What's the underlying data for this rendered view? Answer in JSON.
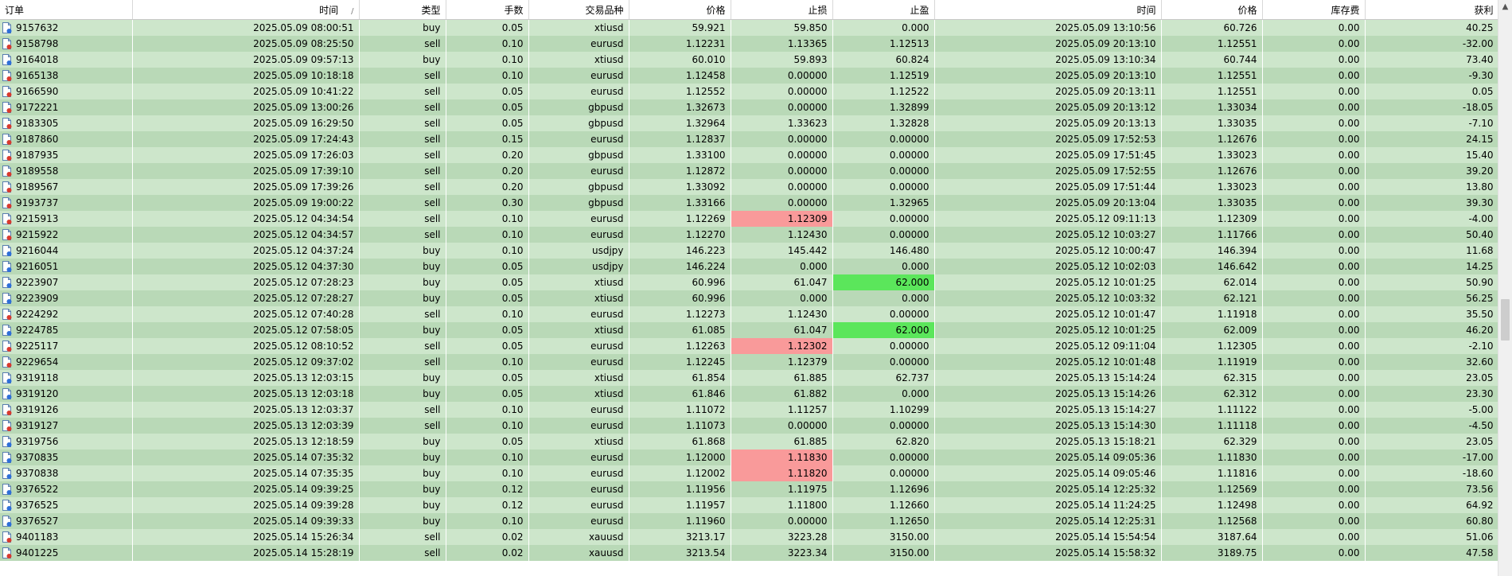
{
  "header": {
    "columns": [
      "订单",
      "时间",
      "类型",
      "手数",
      "交易品种",
      "价格",
      "止损",
      "止盈",
      "时间",
      "价格",
      "库存费",
      "获利"
    ],
    "sort_indicator": "/"
  },
  "rows": [
    {
      "order": "9157632",
      "open_time": "2025.05.09 08:00:51",
      "type": "buy",
      "lots": "0.05",
      "symbol": "xtiusd",
      "price": "59.921",
      "sl": "59.850",
      "tp": "0.000",
      "close_time": "2025.05.09 13:10:56",
      "close_price": "60.726",
      "swap": "0.00",
      "profit": "40.25"
    },
    {
      "order": "9158798",
      "open_time": "2025.05.09 08:25:50",
      "type": "sell",
      "lots": "0.10",
      "symbol": "eurusd",
      "price": "1.12231",
      "sl": "1.13365",
      "tp": "1.12513",
      "close_time": "2025.05.09 20:13:10",
      "close_price": "1.12551",
      "swap": "0.00",
      "profit": "-32.00"
    },
    {
      "order": "9164018",
      "open_time": "2025.05.09 09:57:13",
      "type": "buy",
      "lots": "0.10",
      "symbol": "xtiusd",
      "price": "60.010",
      "sl": "59.893",
      "tp": "60.824",
      "close_time": "2025.05.09 13:10:34",
      "close_price": "60.744",
      "swap": "0.00",
      "profit": "73.40"
    },
    {
      "order": "9165138",
      "open_time": "2025.05.09 10:18:18",
      "type": "sell",
      "lots": "0.10",
      "symbol": "eurusd",
      "price": "1.12458",
      "sl": "0.00000",
      "tp": "1.12519",
      "close_time": "2025.05.09 20:13:10",
      "close_price": "1.12551",
      "swap": "0.00",
      "profit": "-9.30"
    },
    {
      "order": "9166590",
      "open_time": "2025.05.09 10:41:22",
      "type": "sell",
      "lots": "0.05",
      "symbol": "eurusd",
      "price": "1.12552",
      "sl": "0.00000",
      "tp": "1.12522",
      "close_time": "2025.05.09 20:13:11",
      "close_price": "1.12551",
      "swap": "0.00",
      "profit": "0.05"
    },
    {
      "order": "9172221",
      "open_time": "2025.05.09 13:00:26",
      "type": "sell",
      "lots": "0.05",
      "symbol": "gbpusd",
      "price": "1.32673",
      "sl": "0.00000",
      "tp": "1.32899",
      "close_time": "2025.05.09 20:13:12",
      "close_price": "1.33034",
      "swap": "0.00",
      "profit": "-18.05"
    },
    {
      "order": "9183305",
      "open_time": "2025.05.09 16:29:50",
      "type": "sell",
      "lots": "0.05",
      "symbol": "gbpusd",
      "price": "1.32964",
      "sl": "1.33623",
      "tp": "1.32828",
      "close_time": "2025.05.09 20:13:13",
      "close_price": "1.33035",
      "swap": "0.00",
      "profit": "-7.10"
    },
    {
      "order": "9187860",
      "open_time": "2025.05.09 17:24:43",
      "type": "sell",
      "lots": "0.15",
      "symbol": "eurusd",
      "price": "1.12837",
      "sl": "0.00000",
      "tp": "0.00000",
      "close_time": "2025.05.09 17:52:53",
      "close_price": "1.12676",
      "swap": "0.00",
      "profit": "24.15"
    },
    {
      "order": "9187935",
      "open_time": "2025.05.09 17:26:03",
      "type": "sell",
      "lots": "0.20",
      "symbol": "gbpusd",
      "price": "1.33100",
      "sl": "0.00000",
      "tp": "0.00000",
      "close_time": "2025.05.09 17:51:45",
      "close_price": "1.33023",
      "swap": "0.00",
      "profit": "15.40"
    },
    {
      "order": "9189558",
      "open_time": "2025.05.09 17:39:10",
      "type": "sell",
      "lots": "0.20",
      "symbol": "eurusd",
      "price": "1.12872",
      "sl": "0.00000",
      "tp": "0.00000",
      "close_time": "2025.05.09 17:52:55",
      "close_price": "1.12676",
      "swap": "0.00",
      "profit": "39.20"
    },
    {
      "order": "9189567",
      "open_time": "2025.05.09 17:39:26",
      "type": "sell",
      "lots": "0.20",
      "symbol": "gbpusd",
      "price": "1.33092",
      "sl": "0.00000",
      "tp": "0.00000",
      "close_time": "2025.05.09 17:51:44",
      "close_price": "1.33023",
      "swap": "0.00",
      "profit": "13.80"
    },
    {
      "order": "9193737",
      "open_time": "2025.05.09 19:00:22",
      "type": "sell",
      "lots": "0.30",
      "symbol": "gbpusd",
      "price": "1.33166",
      "sl": "0.00000",
      "tp": "1.32965",
      "close_time": "2025.05.09 20:13:04",
      "close_price": "1.33035",
      "swap": "0.00",
      "profit": "39.30"
    },
    {
      "order": "9215913",
      "open_time": "2025.05.12 04:34:54",
      "type": "sell",
      "lots": "0.10",
      "symbol": "eurusd",
      "price": "1.12269",
      "sl": "1.12309",
      "tp": "0.00000",
      "close_time": "2025.05.12 09:11:13",
      "close_price": "1.12309",
      "swap": "0.00",
      "profit": "-4.00",
      "sl_hl": "red"
    },
    {
      "order": "9215922",
      "open_time": "2025.05.12 04:34:57",
      "type": "sell",
      "lots": "0.10",
      "symbol": "eurusd",
      "price": "1.12270",
      "sl": "1.12430",
      "tp": "0.00000",
      "close_time": "2025.05.12 10:03:27",
      "close_price": "1.11766",
      "swap": "0.00",
      "profit": "50.40"
    },
    {
      "order": "9216044",
      "open_time": "2025.05.12 04:37:24",
      "type": "buy",
      "lots": "0.10",
      "symbol": "usdjpy",
      "price": "146.223",
      "sl": "145.442",
      "tp": "146.480",
      "close_time": "2025.05.12 10:00:47",
      "close_price": "146.394",
      "swap": "0.00",
      "profit": "11.68"
    },
    {
      "order": "9216051",
      "open_time": "2025.05.12 04:37:30",
      "type": "buy",
      "lots": "0.05",
      "symbol": "usdjpy",
      "price": "146.224",
      "sl": "0.000",
      "tp": "0.000",
      "close_time": "2025.05.12 10:02:03",
      "close_price": "146.642",
      "swap": "0.00",
      "profit": "14.25"
    },
    {
      "order": "9223907",
      "open_time": "2025.05.12 07:28:23",
      "type": "buy",
      "lots": "0.05",
      "symbol": "xtiusd",
      "price": "60.996",
      "sl": "61.047",
      "tp": "62.000",
      "close_time": "2025.05.12 10:01:25",
      "close_price": "62.014",
      "swap": "0.00",
      "profit": "50.90",
      "tp_hl": "green"
    },
    {
      "order": "9223909",
      "open_time": "2025.05.12 07:28:27",
      "type": "buy",
      "lots": "0.05",
      "symbol": "xtiusd",
      "price": "60.996",
      "sl": "0.000",
      "tp": "0.000",
      "close_time": "2025.05.12 10:03:32",
      "close_price": "62.121",
      "swap": "0.00",
      "profit": "56.25"
    },
    {
      "order": "9224292",
      "open_time": "2025.05.12 07:40:28",
      "type": "sell",
      "lots": "0.10",
      "symbol": "eurusd",
      "price": "1.12273",
      "sl": "1.12430",
      "tp": "0.00000",
      "close_time": "2025.05.12 10:01:47",
      "close_price": "1.11918",
      "swap": "0.00",
      "profit": "35.50"
    },
    {
      "order": "9224785",
      "open_time": "2025.05.12 07:58:05",
      "type": "buy",
      "lots": "0.05",
      "symbol": "xtiusd",
      "price": "61.085",
      "sl": "61.047",
      "tp": "62.000",
      "close_time": "2025.05.12 10:01:25",
      "close_price": "62.009",
      "swap": "0.00",
      "profit": "46.20",
      "tp_hl": "green"
    },
    {
      "order": "9225117",
      "open_time": "2025.05.12 08:10:52",
      "type": "sell",
      "lots": "0.05",
      "symbol": "eurusd",
      "price": "1.12263",
      "sl": "1.12302",
      "tp": "0.00000",
      "close_time": "2025.05.12 09:11:04",
      "close_price": "1.12305",
      "swap": "0.00",
      "profit": "-2.10",
      "sl_hl": "red"
    },
    {
      "order": "9229654",
      "open_time": "2025.05.12 09:37:02",
      "type": "sell",
      "lots": "0.10",
      "symbol": "eurusd",
      "price": "1.12245",
      "sl": "1.12379",
      "tp": "0.00000",
      "close_time": "2025.05.12 10:01:48",
      "close_price": "1.11919",
      "swap": "0.00",
      "profit": "32.60"
    },
    {
      "order": "9319118",
      "open_time": "2025.05.13 12:03:15",
      "type": "buy",
      "lots": "0.05",
      "symbol": "xtiusd",
      "price": "61.854",
      "sl": "61.885",
      "tp": "62.737",
      "close_time": "2025.05.13 15:14:24",
      "close_price": "62.315",
      "swap": "0.00",
      "profit": "23.05"
    },
    {
      "order": "9319120",
      "open_time": "2025.05.13 12:03:18",
      "type": "buy",
      "lots": "0.05",
      "symbol": "xtiusd",
      "price": "61.846",
      "sl": "61.882",
      "tp": "0.000",
      "close_time": "2025.05.13 15:14:26",
      "close_price": "62.312",
      "swap": "0.00",
      "profit": "23.30"
    },
    {
      "order": "9319126",
      "open_time": "2025.05.13 12:03:37",
      "type": "sell",
      "lots": "0.10",
      "symbol": "eurusd",
      "price": "1.11072",
      "sl": "1.11257",
      "tp": "1.10299",
      "close_time": "2025.05.13 15:14:27",
      "close_price": "1.11122",
      "swap": "0.00",
      "profit": "-5.00"
    },
    {
      "order": "9319127",
      "open_time": "2025.05.13 12:03:39",
      "type": "sell",
      "lots": "0.10",
      "symbol": "eurusd",
      "price": "1.11073",
      "sl": "0.00000",
      "tp": "0.00000",
      "close_time": "2025.05.13 15:14:30",
      "close_price": "1.11118",
      "swap": "0.00",
      "profit": "-4.50"
    },
    {
      "order": "9319756",
      "open_time": "2025.05.13 12:18:59",
      "type": "buy",
      "lots": "0.05",
      "symbol": "xtiusd",
      "price": "61.868",
      "sl": "61.885",
      "tp": "62.820",
      "close_time": "2025.05.13 15:18:21",
      "close_price": "62.329",
      "swap": "0.00",
      "profit": "23.05"
    },
    {
      "order": "9370835",
      "open_time": "2025.05.14 07:35:32",
      "type": "buy",
      "lots": "0.10",
      "symbol": "eurusd",
      "price": "1.12000",
      "sl": "1.11830",
      "tp": "0.00000",
      "close_time": "2025.05.14 09:05:36",
      "close_price": "1.11830",
      "swap": "0.00",
      "profit": "-17.00",
      "sl_hl": "red"
    },
    {
      "order": "9370838",
      "open_time": "2025.05.14 07:35:35",
      "type": "buy",
      "lots": "0.10",
      "symbol": "eurusd",
      "price": "1.12002",
      "sl": "1.11820",
      "tp": "0.00000",
      "close_time": "2025.05.14 09:05:46",
      "close_price": "1.11816",
      "swap": "0.00",
      "profit": "-18.60",
      "sl_hl": "red"
    },
    {
      "order": "9376522",
      "open_time": "2025.05.14 09:39:25",
      "type": "buy",
      "lots": "0.12",
      "symbol": "eurusd",
      "price": "1.11956",
      "sl": "1.11975",
      "tp": "1.12696",
      "close_time": "2025.05.14 12:25:32",
      "close_price": "1.12569",
      "swap": "0.00",
      "profit": "73.56"
    },
    {
      "order": "9376525",
      "open_time": "2025.05.14 09:39:28",
      "type": "buy",
      "lots": "0.12",
      "symbol": "eurusd",
      "price": "1.11957",
      "sl": "1.11800",
      "tp": "1.12660",
      "close_time": "2025.05.14 11:24:25",
      "close_price": "1.12498",
      "swap": "0.00",
      "profit": "64.92"
    },
    {
      "order": "9376527",
      "open_time": "2025.05.14 09:39:33",
      "type": "buy",
      "lots": "0.10",
      "symbol": "eurusd",
      "price": "1.11960",
      "sl": "0.00000",
      "tp": "1.12650",
      "close_time": "2025.05.14 12:25:31",
      "close_price": "1.12568",
      "swap": "0.00",
      "profit": "60.80"
    },
    {
      "order": "9401183",
      "open_time": "2025.05.14 15:26:34",
      "type": "sell",
      "lots": "0.02",
      "symbol": "xauusd",
      "price": "3213.17",
      "sl": "3223.28",
      "tp": "3150.00",
      "close_time": "2025.05.14 15:54:54",
      "close_price": "3187.64",
      "swap": "0.00",
      "profit": "51.06"
    },
    {
      "order": "9401225",
      "open_time": "2025.05.14 15:28:19",
      "type": "sell",
      "lots": "0.02",
      "symbol": "xauusd",
      "price": "3213.54",
      "sl": "3223.34",
      "tp": "3150.00",
      "close_time": "2025.05.14 15:58:32",
      "close_price": "3189.75",
      "swap": "0.00",
      "profit": "47.58"
    }
  ],
  "colors": {
    "row_odd": "#cde6cb",
    "row_even": "#b9d9b7",
    "sl_highlight": "#f99a9a",
    "tp_highlight": "#5be65b"
  },
  "icons": {
    "row_icon": "trade-document-icon",
    "scroll_up": "chevron-up-icon"
  }
}
